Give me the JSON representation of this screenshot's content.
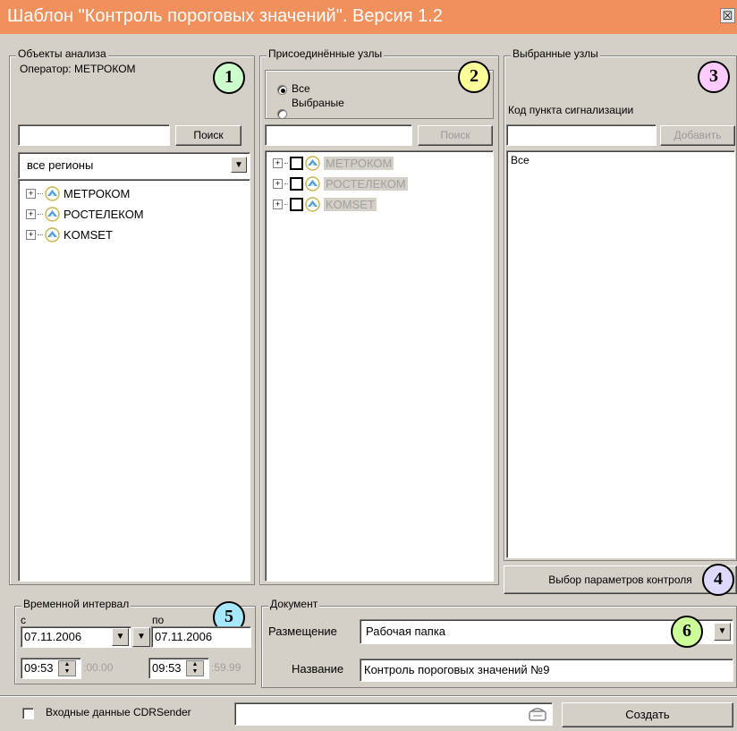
{
  "window": {
    "title": "Шаблон \"Контроль пороговых значений\". Версия 1.2",
    "close_glyph": "☒"
  },
  "badges": [
    "1",
    "2",
    "3",
    "4",
    "5",
    "6"
  ],
  "analysis": {
    "legend": "Объекты анализа",
    "operator": "Оператор: МЕТРОКОМ",
    "search_value": "",
    "search_button": "Поиск",
    "region_select": "все регионы",
    "tree": [
      {
        "label": "МЕТРОКОМ"
      },
      {
        "label": "РОСТЕЛЕКОМ"
      },
      {
        "label": "KOMSET"
      }
    ]
  },
  "attached": {
    "legend": "Присоединённые узлы",
    "radio_all": "Все",
    "radio_selected": "Выбраные",
    "selected_option": "Все",
    "search_value": "",
    "search_button": "Поиск",
    "tree": [
      {
        "label": "МЕТРОКОМ"
      },
      {
        "label": "РОСТЕЛЕКОМ"
      },
      {
        "label": "KOMSET"
      }
    ]
  },
  "selected": {
    "legend": "Выбранные узлы",
    "code_label": "Код пункта сигнализации",
    "code_value": "",
    "add_button": "Добавить",
    "list": [
      "Все"
    ],
    "params_button": "Выбор параметров контроля"
  },
  "interval": {
    "legend": "Временной интервал",
    "from_label": "с",
    "to_label": "по",
    "from_date": "07.11.2006",
    "to_date": "07.11.2006",
    "from_time": "09:53",
    "from_seconds": ":00.00",
    "to_time": "09:53",
    "to_seconds": ":59.99"
  },
  "document": {
    "legend": "Документ",
    "placement_label": "Размещение",
    "placement_value": "Рабочая папка",
    "name_label": "Название",
    "name_value": "Контроль пороговых значений №9"
  },
  "footer": {
    "cdr_label": "Входные данные CDRSender",
    "cdr_checked": false,
    "cdr_value": "",
    "create_button": "Создать"
  }
}
